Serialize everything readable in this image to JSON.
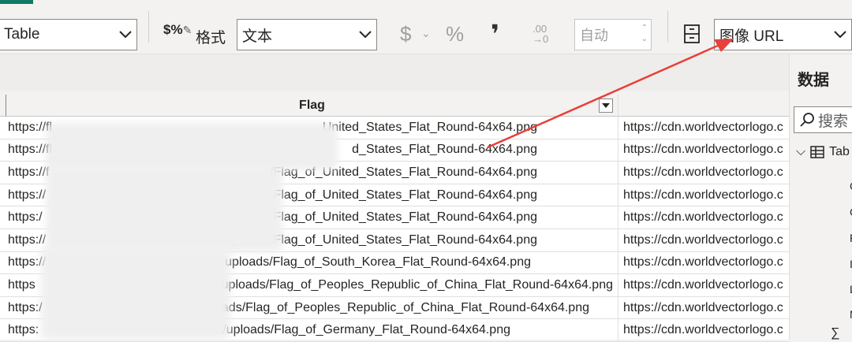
{
  "ribbon": {
    "table_select": "Table",
    "format_label": "格式",
    "format_select": "文本",
    "currency_symbol": "$",
    "percent_symbol": "%",
    "comma_symbol": "❜",
    "decimal_icon_top": ".00",
    "decimal_icon_bottom": "→0",
    "auto_spinner": "自动",
    "data_category_select": "图像 URL"
  },
  "table": {
    "column_header": "Flag",
    "rows": [
      {
        "flag": "https://fl...United_States_Flat_Round-64x64.png",
        "flag_prefix": "https://fl",
        "flag_suffix": "United_States_Flat_Round-64x64.png",
        "url": "https://cdn.worldvectorlogo.c"
      },
      {
        "flag": "https://fl...d_States_Flat_Round-64x64.png",
        "flag_prefix": "https://fl",
        "flag_suffix": "d_States_Flat_Round-64x64.png",
        "url": "https://cdn.worldvectorlogo.c"
      },
      {
        "flag": "https://f...ypload.com/...Flag_of_United_States_Flat_Round-64x64.png",
        "flag_prefix": "https://f",
        "flag_suffix": "/Flag_of_United_States_Flat_Round-64x64.png",
        "url": "https://cdn.worldvectorlogo.c"
      },
      {
        "flag": "https://...ads/Flag_of_United_States_Flat_Round-64x64.png",
        "flag_prefix": "https://",
        "flag_suffix": "ads/Flag_of_United_States_Flat_Round-64x64.png",
        "url": "https://cdn.worldvectorlogo.c"
      },
      {
        "flag": "https:/.../Flag_of_United_States_Flat_Round-64x64.png",
        "flag_prefix": "https:/",
        "flag_suffix": "/Flag_of_United_States_Flat_Round-64x64.png",
        "url": "https://cdn.worldvectorlogo.c"
      },
      {
        "flag": "https://...ploads/Flag_of_United_States_Flat_Round-64x64.png",
        "flag_prefix": "https://",
        "flag_suffix": "ploads/Flag_of_United_States_Flat_Round-64x64.png",
        "url": "https://cdn.worldvectorlogo.c"
      },
      {
        "flag": "https://...uploads/Flag_of_South_Korea_Flat_Round-64x64.png",
        "flag_prefix": "https://",
        "flag_suffix": "uploads/Flag_of_South_Korea_Flat_Round-64x64.png",
        "url": "https://cdn.worldvectorlogo.c"
      },
      {
        "flag": "https...t/uploads/Flag_of_Peoples_Republic_of_China_Flat_Round-64x64.png",
        "flag_prefix": "https",
        "flag_suffix": "t/uploads/Flag_of_Peoples_Republic_of_China_Flat_Round-64x64.png",
        "url": "https://cdn.worldvectorlogo.c"
      },
      {
        "flag": "https:/...ent/uploads/Flag_of_Peoples_Republic_of_China_Flat_Round-64x64.png",
        "flag_prefix": "https:/",
        "flag_suffix": "ent/uploads/Flag_of_Peoples_Republic_of_China_Flat_Round-64x64.png",
        "url": "https://cdn.worldvectorlogo.c"
      },
      {
        "flag": "https:...t/uploads/Flag_of_Germany_Flat_Round-64x64.png",
        "flag_prefix": "https:",
        "flag_suffix": "t/uploads/Flag_of_Germany_Flat_Round-64x64.png",
        "url": "https://cdn.worldvectorlogo.c"
      }
    ]
  },
  "panel": {
    "title": "数据",
    "search_placeholder": "搜索",
    "table_node": "Tab",
    "fields": [
      "C",
      "C",
      "F",
      "I",
      "L",
      "M",
      "F"
    ]
  },
  "colors": {
    "accent": "#117865",
    "annotation_arrow": "#e8403a"
  }
}
